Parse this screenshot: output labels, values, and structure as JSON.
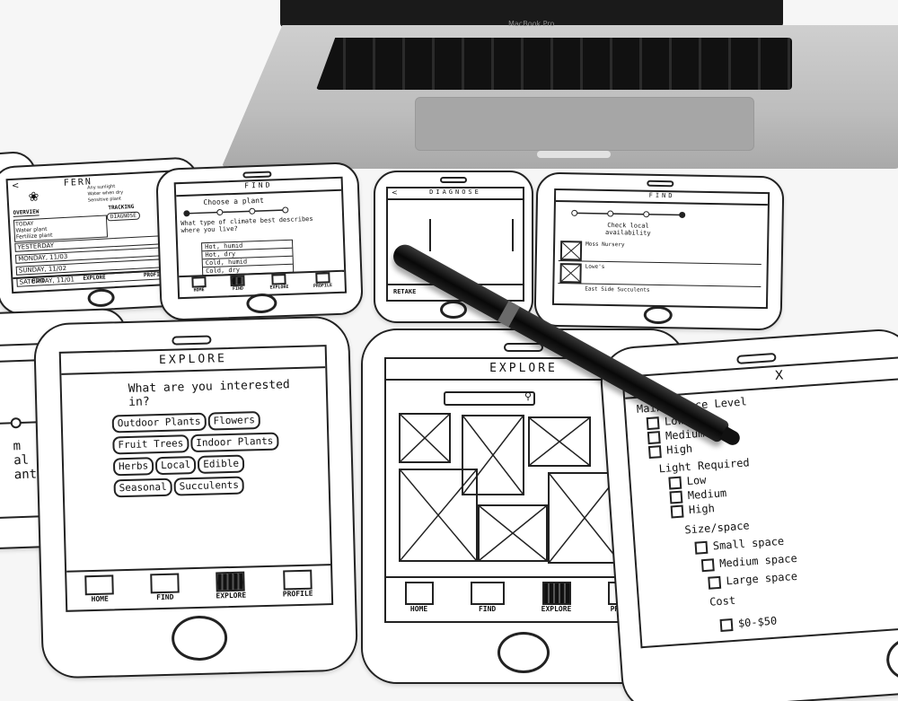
{
  "laptop": {
    "brand": "MacBook Pro"
  },
  "phone_fern": {
    "title": "FERN",
    "care_notes": [
      "Any sunlight",
      "Water when dry",
      "Sensitive plant"
    ],
    "overview_label": "OVERVIEW",
    "tracking_label": "TRACKING",
    "diagnose_button": "DIAGNOSE",
    "today_tasks": [
      "TODAY",
      "Water plant",
      "Fertilize plant"
    ],
    "days": [
      "YESTERDAY",
      "MONDAY, 11/03",
      "SUNDAY, 11/02",
      "SATURDAY, 11/01"
    ],
    "tabs": [
      "FIND",
      "EXPLORE",
      "PROFILE"
    ]
  },
  "phone_find_quiz": {
    "title": "FIND",
    "prompt": "Choose a plant",
    "question": "What type of climate best describes where you live?",
    "options": [
      "Hot, humid",
      "Hot, dry",
      "Cold, humid",
      "Cold, dry"
    ],
    "tabs": [
      "HOME",
      "FIND",
      "EXPLORE",
      "PROFILE"
    ],
    "active_tab": "FIND"
  },
  "phone_diagnose": {
    "title": "DIAGNOSE",
    "back": "<",
    "retake": "RETAKE"
  },
  "phone_find_availability": {
    "title": "FIND",
    "heading": "Check local availability",
    "stores": [
      "Moss Nursery",
      "Lowe's",
      "East Side Succulents"
    ]
  },
  "phone_explore_interests": {
    "title": "EXPLORE",
    "question": "What are you interested in?",
    "chips": [
      "Outdoor Plants",
      "Flowers",
      "Fruit Trees",
      "Indoor Plants",
      "Herbs",
      "Local",
      "Edible",
      "Seasonal",
      "Succulents"
    ],
    "tabs": [
      "HOME",
      "FIND",
      "EXPLORE",
      "PROFILE"
    ],
    "active_tab": "EXPLORE"
  },
  "phone_explore_grid": {
    "title": "EXPLORE",
    "tabs": [
      "HOME",
      "FIND",
      "EXPLORE",
      "PROFILE"
    ],
    "active_tab": "EXPLORE"
  },
  "phone_filters": {
    "close": "X",
    "sections": [
      {
        "heading": "Maintenance Level",
        "options": [
          "Low",
          "Medium",
          "High"
        ]
      },
      {
        "heading": "Light Required",
        "options": [
          "Low",
          "Medium",
          "High"
        ]
      },
      {
        "heading": "Size/space",
        "options": [
          "Small space",
          "Medium space",
          "Large space"
        ]
      },
      {
        "heading": "Cost",
        "options": [
          "$0-$50"
        ]
      }
    ]
  },
  "phone_left_partial": {
    "lines": [
      "m",
      "al",
      "ant."
    ]
  }
}
